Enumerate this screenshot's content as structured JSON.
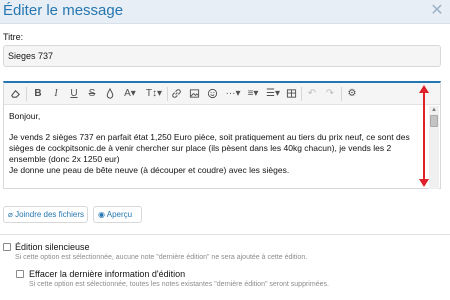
{
  "dialog": {
    "title": "Éditer le message",
    "close_icon": "close-icon"
  },
  "form": {
    "title_label": "Titre:",
    "title_value": "Sieges 737"
  },
  "toolbar": {
    "icons": [
      "eraser-icon",
      "bold-icon",
      "italic-icon",
      "underline-icon",
      "strikethrough-icon",
      "text-color-icon",
      "font-family-icon",
      "font-size-icon",
      "link-icon",
      "image-icon",
      "smilie-icon",
      "more-options-icon",
      "align-icon",
      "list-icon",
      "table-icon",
      "undo-icon",
      "redo-icon",
      "settings-icon"
    ]
  },
  "editor": {
    "paragraphs": [
      "Bonjour,",
      "",
      "Je vends 2 sièges 737 en parfait état 1,250 Euro pièce, soit pratiquement au tiers du prix neuf, ce sont des sièges de cockpitsonic.de à  venir chercher sur place (ils pèsent dans les 40kg chacun), je vends les 2 ensemble (donc 2x 1250 eur)",
      "Je donne une peau de bête neuve (à  découper et coudre) avec les sièges."
    ],
    "annotation_color": "#e0202a"
  },
  "buttons": {
    "attach_label": "Joindre des fichiers",
    "preview_label": "Aperçu"
  },
  "options": {
    "silent_edit_label": "Édition silencieuse",
    "silent_edit_hint": "Si cette option est sélectionnée, aucune note \"dernière édition\" ne sera ajoutée à cette édition.",
    "clear_last_label": "Effacer la dernière information d'édition",
    "clear_last_hint": "Si cette option est sélectionnée, toutes les notes existantes \"dernière édition\" seront supprimées."
  },
  "colors": {
    "accent": "#2577b1",
    "header_bg": "#e8eef5",
    "annotation": "#e0202a"
  }
}
